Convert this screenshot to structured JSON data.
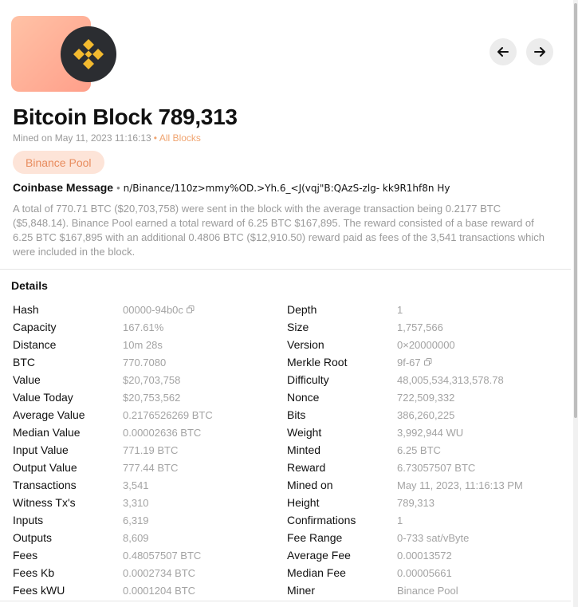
{
  "header": {
    "title": "Bitcoin Block",
    "block_number": "789,313",
    "mined_on": "Mined on May 11, 2023 11:16:13",
    "all_blocks_link": "All Blocks",
    "pool_badge": "Binance Pool",
    "logo_icon": "binance-logo-icon",
    "colors": {
      "accent": "#f0a470",
      "badge_bg": "#fde4d8",
      "binance_yellow": "#f3ba2f"
    }
  },
  "coinbase": {
    "label": "Coinbase Message",
    "message": "n/Binance/110z>mmy%OD.>Yh.6_<J(vqj\"B:QAzS-zlg- kk9R1hf8n Hy"
  },
  "summary": "A total of 770.71 BTC ($20,703,758) were sent in the block with the average transaction being 0.2177 BTC ($5,848.14). Binance Pool earned a total reward of 6.25 BTC $167,895. The reward consisted of a base reward of 6.25 BTC $167,895 with an additional 0.4806 BTC ($12,910.50) reward paid as fees of the 3,541 transactions which were included in the block.",
  "details": {
    "title": "Details",
    "left": [
      {
        "key": "Hash",
        "value": "00000-94b0c",
        "copy": true
      },
      {
        "key": "Capacity",
        "value": "167.61%"
      },
      {
        "key": "Distance",
        "value": "10m 28s"
      },
      {
        "key": "BTC",
        "value": "770.7080"
      },
      {
        "key": "Value",
        "value": "$20,703,758"
      },
      {
        "key": "Value Today",
        "value": "$20,753,562"
      },
      {
        "key": "Average Value",
        "value": "0.2176526269 BTC"
      },
      {
        "key": "Median Value",
        "value": "0.00002636 BTC"
      },
      {
        "key": "Input Value",
        "value": "771.19 BTC"
      },
      {
        "key": "Output Value",
        "value": "777.44 BTC"
      },
      {
        "key": "Transactions",
        "value": "3,541"
      },
      {
        "key": "Witness Tx's",
        "value": "3,310"
      },
      {
        "key": "Inputs",
        "value": "6,319"
      },
      {
        "key": "Outputs",
        "value": "8,609"
      },
      {
        "key": "Fees",
        "value": "0.48057507 BTC"
      },
      {
        "key": "Fees Kb",
        "value": "0.0002734 BTC"
      },
      {
        "key": "Fees kWU",
        "value": "0.0001204 BTC"
      }
    ],
    "right": [
      {
        "key": "Depth",
        "value": "1"
      },
      {
        "key": "Size",
        "value": "1,757,566"
      },
      {
        "key": "Version",
        "value": "0×20000000"
      },
      {
        "key": "Merkle Root",
        "value": "9f-67",
        "copy": true
      },
      {
        "key": "Difficulty",
        "value": "48,005,534,313,578.78"
      },
      {
        "key": "Nonce",
        "value": "722,509,332"
      },
      {
        "key": "Bits",
        "value": "386,260,225"
      },
      {
        "key": "Weight",
        "value": "3,992,944 WU"
      },
      {
        "key": "Minted",
        "value": "6.25 BTC"
      },
      {
        "key": "Reward",
        "value": "6.73057507 BTC"
      },
      {
        "key": "Mined on",
        "value": "May 11, 2023, 11:16:13 PM"
      },
      {
        "key": "Height",
        "value": "789,313"
      },
      {
        "key": "Confirmations",
        "value": "1"
      },
      {
        "key": "Fee Range",
        "value": "0-733 sat/vByte"
      },
      {
        "key": "Average Fee",
        "value": "0.00013572"
      },
      {
        "key": "Median Fee",
        "value": "0.00005661"
      },
      {
        "key": "Miner",
        "value": "Binance Pool"
      }
    ]
  }
}
